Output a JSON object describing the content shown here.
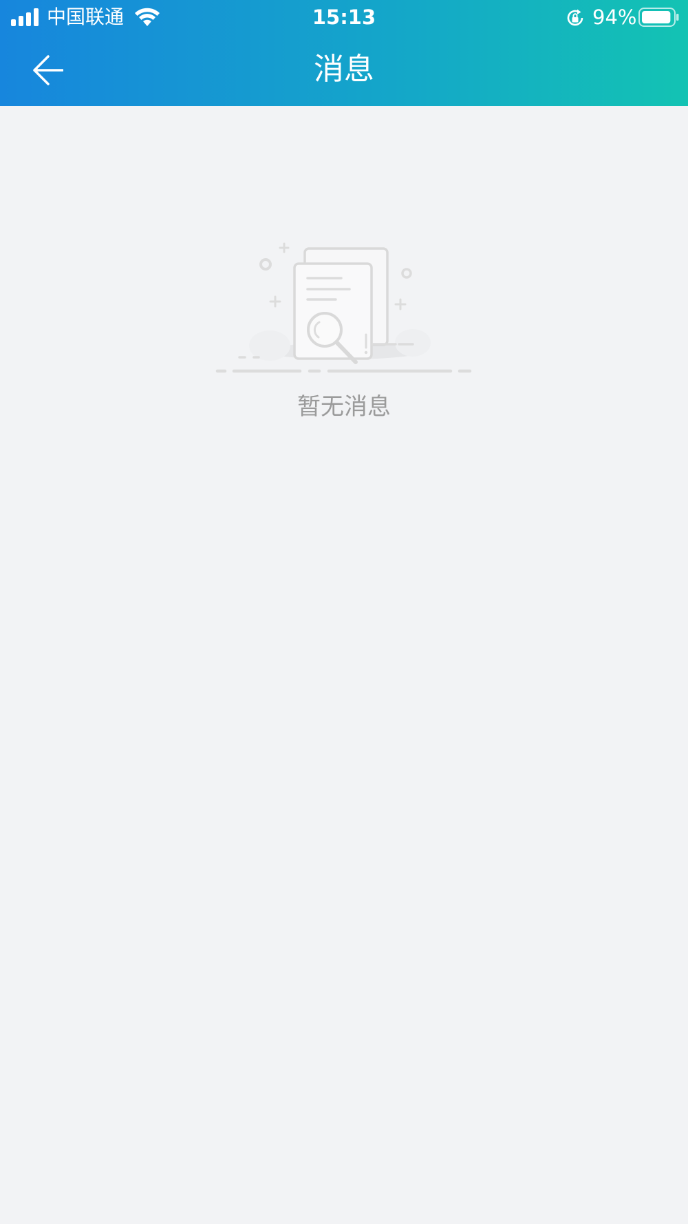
{
  "status_bar": {
    "carrier": "中国联通",
    "time": "15:13",
    "battery_percent": "94%",
    "battery_level": 0.94
  },
  "nav": {
    "title": "消息"
  },
  "empty": {
    "message": "暂无消息"
  },
  "icons": [
    "signal-icon",
    "wifi-icon",
    "rotation-lock-icon",
    "battery-icon",
    "back-arrow-icon",
    "empty-document-search-icon"
  ],
  "colors": {
    "header_gradient_start": "#1786dd",
    "header_gradient_end": "#13c3b3",
    "background": "#f2f3f5",
    "empty_text": "#9b9b9b"
  }
}
